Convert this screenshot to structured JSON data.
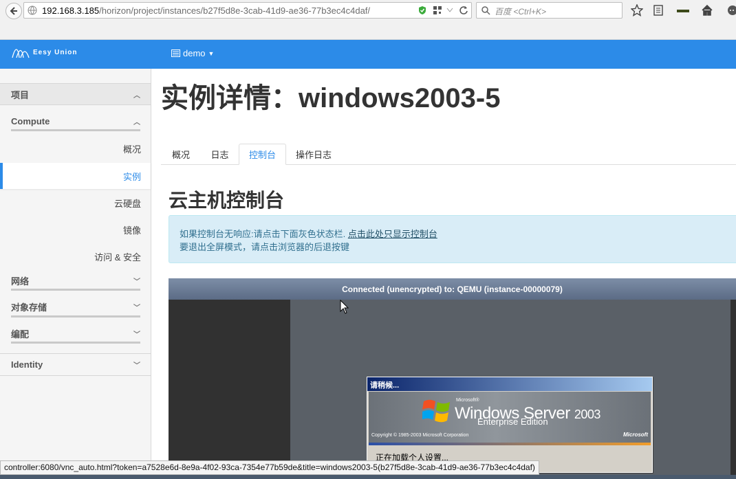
{
  "browser": {
    "url_host": "192.168.3.185",
    "url_path": "/horizon/project/instances/b27f5d8e-3cab-41d9-ae36-77b3ec4c4daf/",
    "search_placeholder": "百度 <Ctrl+K>",
    "status_url": "controller:6080/vnc_auto.html?token=a7528e6d-8e9a-4f02-93ca-7354e77b59de&title=windows2003-5(b27f5d8e-3cab-41d9-ae36-77b3ec4c4daf)"
  },
  "topbar": {
    "brand": "Eesy Union",
    "project": "demo",
    "accent_color": "#2c8be8"
  },
  "sidebar": {
    "section_project": "项目",
    "group_compute": "Compute",
    "items": [
      "概况",
      "实例",
      "云硬盘",
      "镜像",
      "访问 & 安全"
    ],
    "active_item": "实例",
    "group_network": "网络",
    "group_object_storage": "对象存储",
    "group_orchestration": "编配",
    "section_identity": "Identity"
  },
  "main": {
    "title": "实例详情：windows2003-5",
    "tabs": [
      "概况",
      "日志",
      "控制台",
      "操作日志"
    ],
    "active_tab": "控制台",
    "section_title": "云主机控制台",
    "alert_line1": "如果控制台无响应:请点击下面灰色状态栏. ",
    "alert_link": "点击此处只显示控制台",
    "alert_line2": "要退出全屏模式，请点击浏览器的后退按键"
  },
  "console": {
    "status": "Connected (unencrypted) to: QEMU (instance-00000079)",
    "dialog_title": "请稍候...",
    "microsoft_small": "Microsoft®",
    "product": "Windows Server",
    "product_year": "2003",
    "edition": "Enterprise Edition",
    "copyright": "Copyright © 1985-2003  Microsoft Corporation",
    "ms_logo": "Microsoft",
    "message": "正在加载个人设置..."
  }
}
